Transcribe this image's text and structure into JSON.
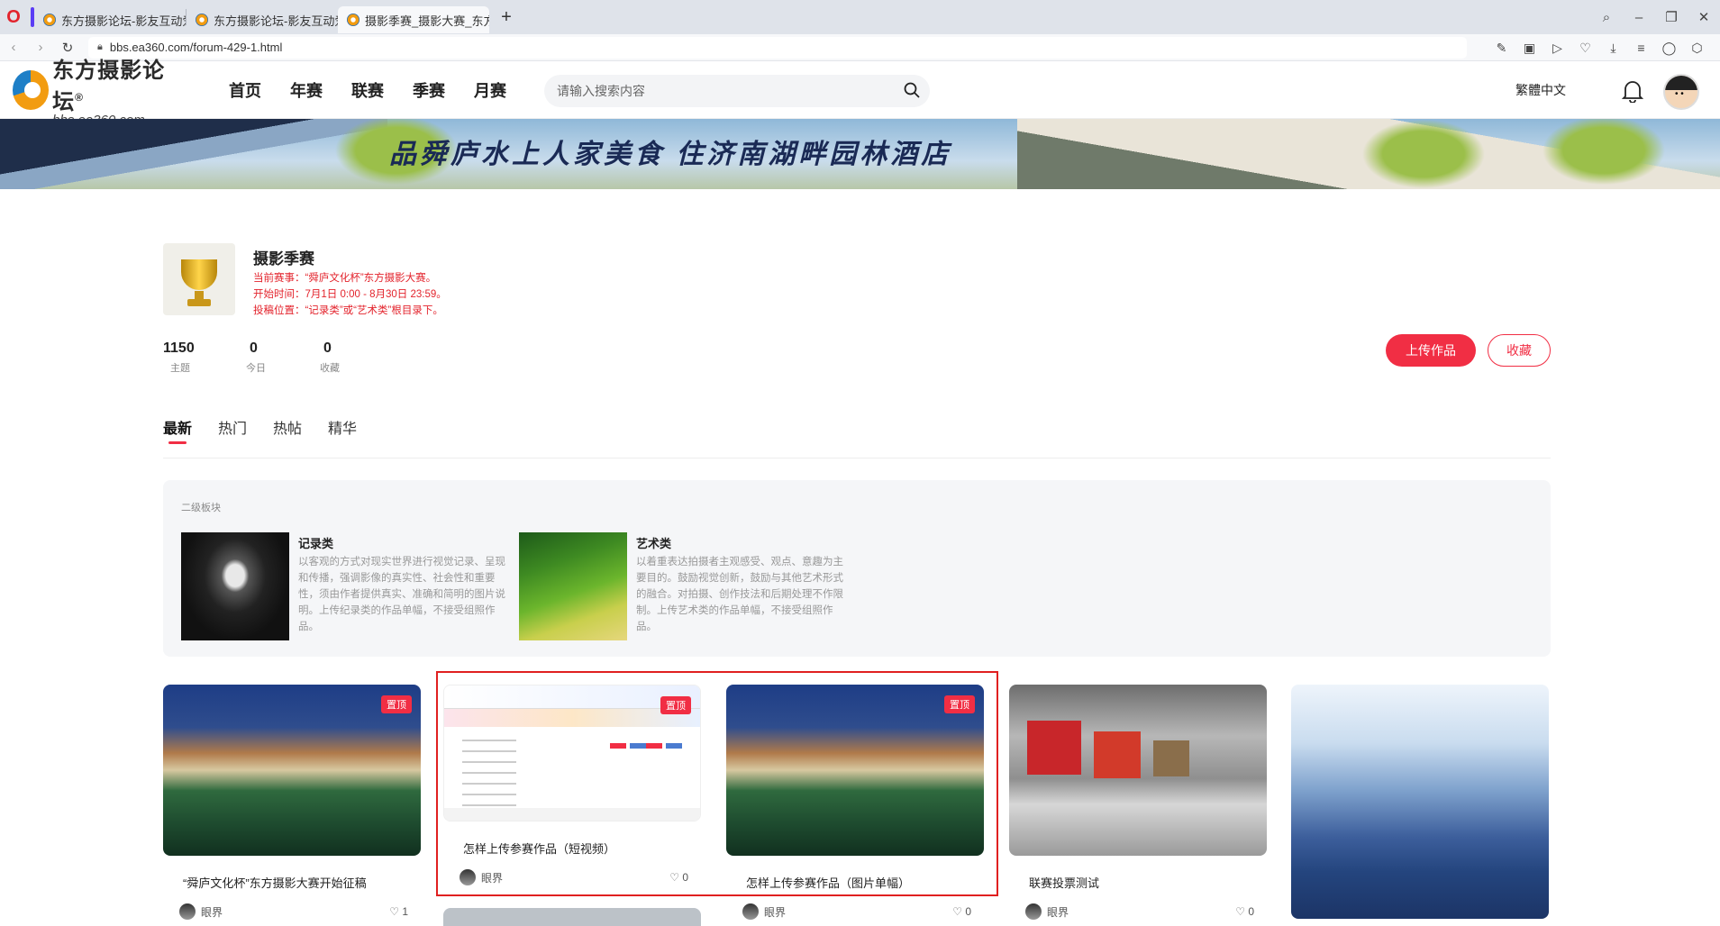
{
  "browser": {
    "tabs": [
      {
        "label": "东方摄影论坛-影友互动爱",
        "active": false
      },
      {
        "label": "东方摄影论坛-影友互动爱",
        "active": false
      },
      {
        "label": "摄影季赛_摄影大赛_东方摄",
        "active": true
      }
    ],
    "url": "bbs.ea360.com/forum-429-1.html"
  },
  "site": {
    "logo_cn": "东方摄影论坛",
    "logo_en": "bbs.ea360.com",
    "logo_reg": "®",
    "nav": [
      "首页",
      "年赛",
      "联赛",
      "季赛",
      "月赛"
    ],
    "search_placeholder": "请输入搜索内容",
    "lang": "繁體中文"
  },
  "banner": {
    "text": "品舜庐水上人家美食  住济南湖畔园林酒店"
  },
  "forum": {
    "title": "摄影季赛",
    "info": [
      "当前赛事：“舜庐文化杯”东方摄影大赛。",
      "开始时间：7月1日 0:00 - 8月30日 23:59。",
      "投稿位置：“记录类”或“艺术类”根目录下。"
    ],
    "stats": [
      {
        "num": "1150",
        "label": "主题"
      },
      {
        "num": "0",
        "label": "今日"
      },
      {
        "num": "0",
        "label": "收藏"
      }
    ],
    "upload_label": "上传作品",
    "fav_label": "收藏"
  },
  "tabs": [
    "最新",
    "热门",
    "热帖",
    "精华"
  ],
  "subboards": {
    "header": "二级板块",
    "items": [
      {
        "name": "记录类",
        "desc": "以客观的方式对现实世界进行视觉记录、呈现和传播，强调影像的真实性、社会性和重要性，须由作者提供真实、准确和简明的图片说明。上传纪录类的作品单幅，不接受组照作品。"
      },
      {
        "name": "艺术类",
        "desc": "以着重表达拍摄者主观感受、观点、意趣为主要目的。鼓励视觉创新，鼓励与其他艺术形式的融合。对拍摄、创作技法和后期处理不作限制。上传艺术类的作品单幅，不接受组照作品。"
      }
    ]
  },
  "posts": [
    {
      "title": "“舜庐文化杯”东方摄影大赛开始征稿",
      "author": "眼界",
      "likes": "1",
      "badge": "置顶"
    },
    {
      "title": "怎样上传参赛作品（短视频）",
      "author": "眼界",
      "likes": "0",
      "badge": "置顶"
    },
    {
      "title": "怎样上传参赛作品（图片单幅）",
      "author": "眼界",
      "likes": "0",
      "badge": "置顶"
    },
    {
      "title": "联赛投票测试",
      "author": "眼界",
      "likes": "0",
      "badge": ""
    }
  ]
}
